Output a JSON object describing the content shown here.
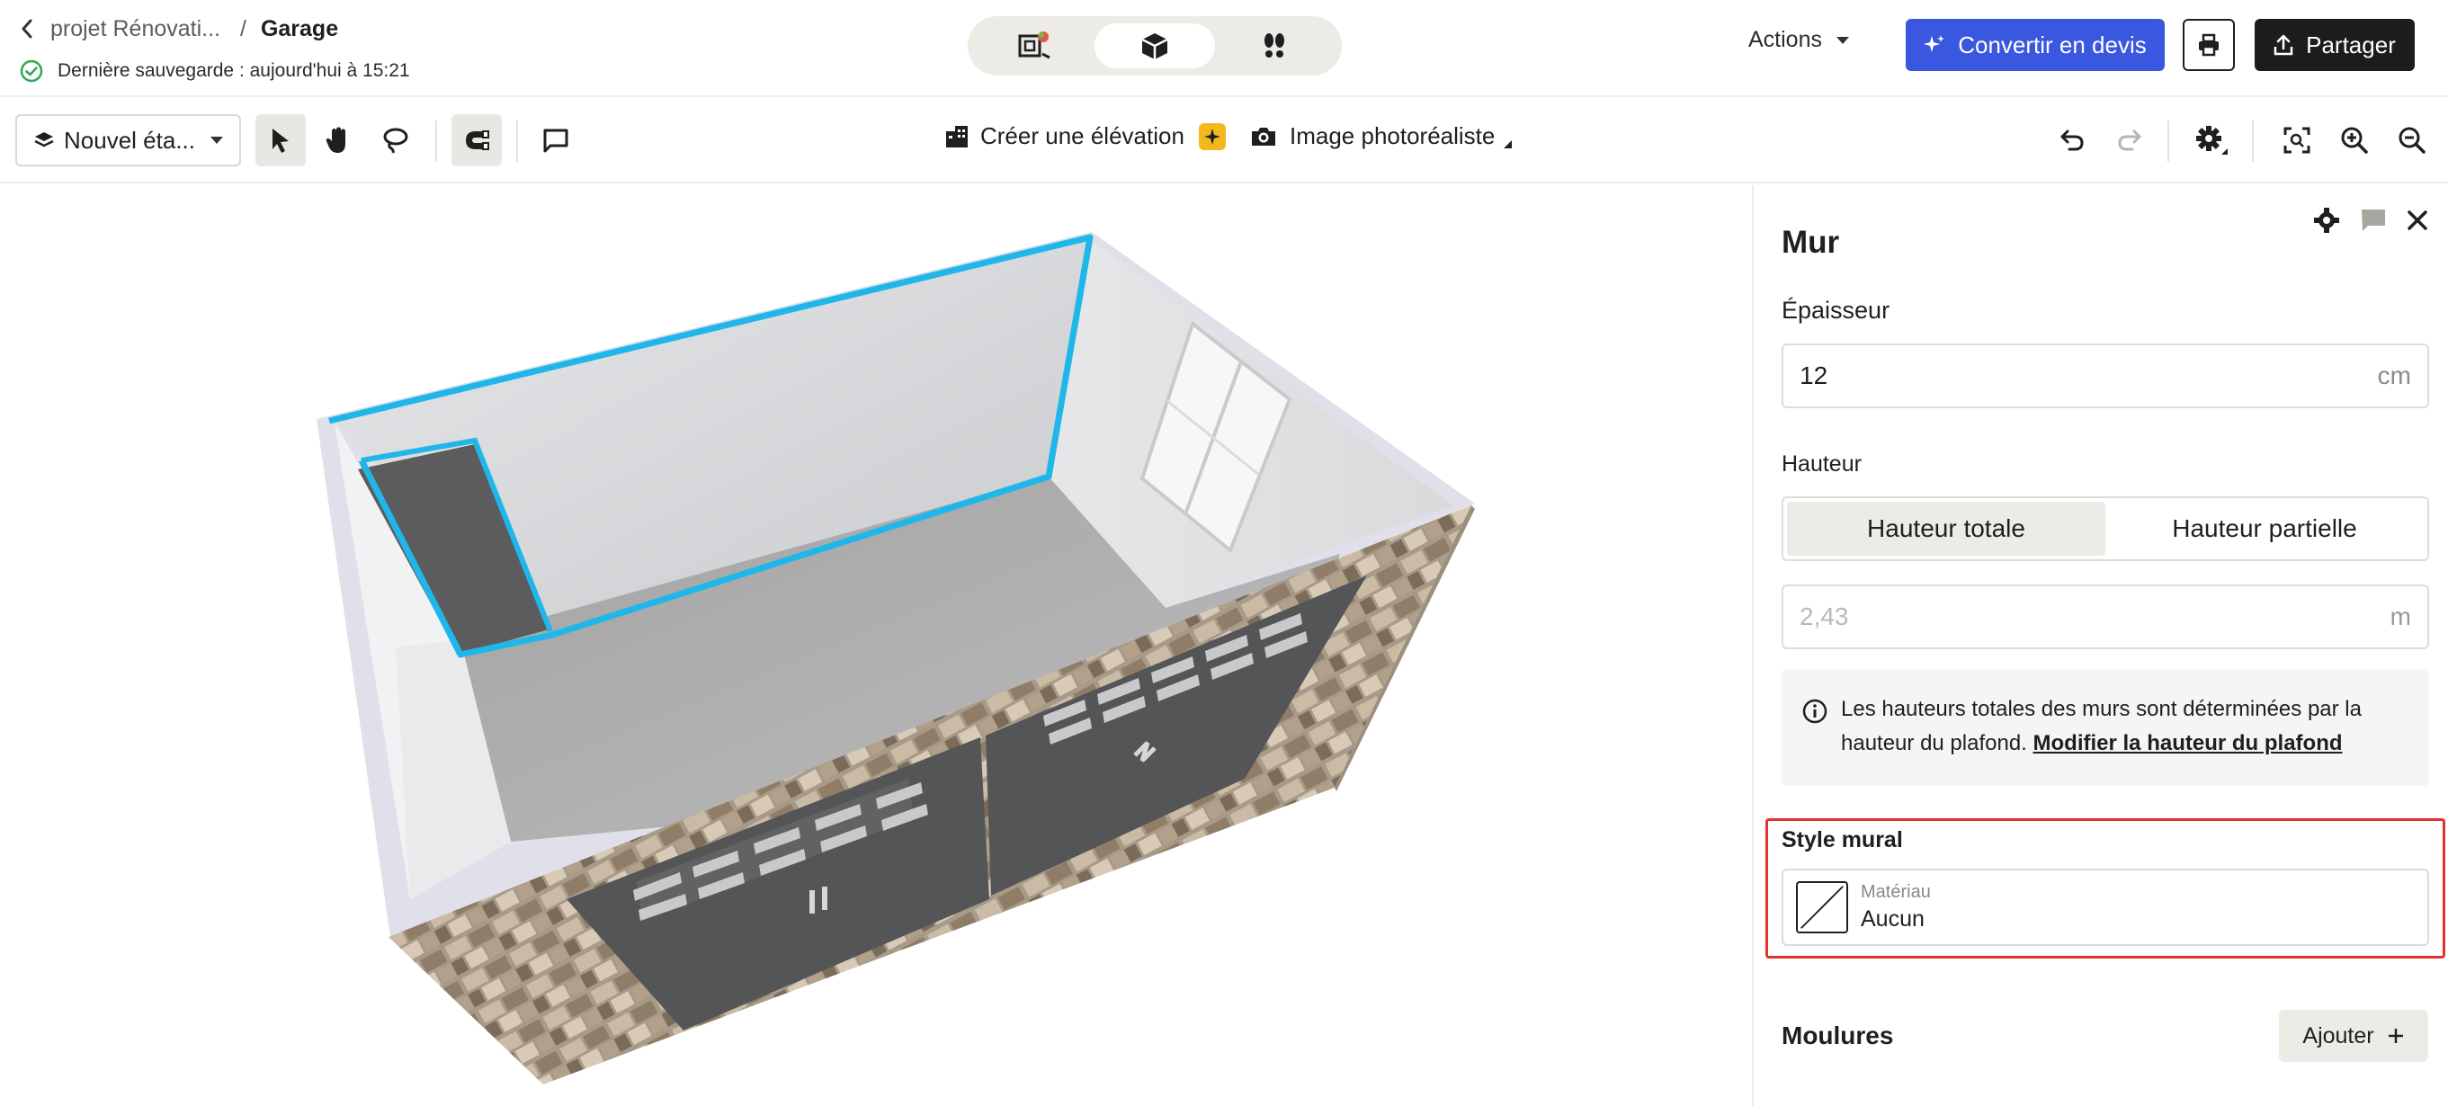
{
  "header": {
    "project_name": "projet Rénovati...",
    "separator": "/",
    "room_name": "Garage",
    "save_status": "Dernière sauvegarde : aujourd'hui à 15:21",
    "view_modes": [
      "plan-2d-icon",
      "view-3d-icon",
      "walkthrough-icon"
    ],
    "active_view": "view-3d-icon",
    "actions_label": "Actions",
    "convert_label": "Convertir en devis",
    "share_label": "Partager",
    "accent_color": "#3a57e0"
  },
  "toolbar": {
    "floor_label": "Nouvel éta...",
    "elevation_label": "Créer une élévation",
    "photo_label": "Image photoréaliste"
  },
  "panel": {
    "title": "Mur",
    "thickness_label": "Épaisseur",
    "thickness_value": "12",
    "thickness_unit": "cm",
    "height_label": "Hauteur",
    "height_options": [
      "Hauteur totale",
      "Hauteur partielle"
    ],
    "height_selected": "Hauteur totale",
    "height_value": "2,43",
    "height_unit": "m",
    "info_text": "Les hauteurs totales des murs sont déterminées par la hauteur du plafond.",
    "info_link": "Modifier la hauteur du plafond",
    "wall_style_label": "Style mural",
    "material_label": "Matériau",
    "material_value": "Aucun",
    "moldings_label": "Moulures",
    "add_label": "Ajouter",
    "highlight_color": "#e0332a"
  }
}
